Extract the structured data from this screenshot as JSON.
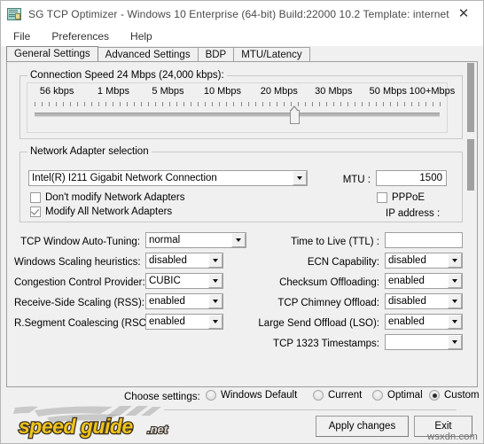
{
  "window": {
    "title": "SG TCP Optimizer - Windows 10 Enterprise (64-bit) Build:22000 10.2  Template: internet",
    "icon": "app-icon",
    "close_label": "✕"
  },
  "menu": {
    "items": [
      {
        "label": "File"
      },
      {
        "label": "Preferences"
      },
      {
        "label": "Help"
      }
    ]
  },
  "tabs": [
    {
      "label": "General Settings",
      "active": true
    },
    {
      "label": "Advanced Settings",
      "active": false
    },
    {
      "label": "BDP",
      "active": false
    },
    {
      "label": "MTU/Latency",
      "active": false
    }
  ],
  "connection_speed": {
    "group_title": "Connection Speed  24 Mbps (24,000 kbps):",
    "scale_labels": [
      "56 kbps",
      "1 Mbps",
      "5 Mbps",
      "10 Mbps",
      "20 Mbps",
      "30 Mbps",
      "50 Mbps",
      "100+Mbps"
    ],
    "value_mbps": 24,
    "value_kbps": 24000,
    "slider_percent": 62
  },
  "network_adapter": {
    "group_title": "Network Adapter selection",
    "adapter_value": "Intel(R) I211 Gigabit Network Connection",
    "dont_modify": {
      "label": "Don't modify Network Adapters",
      "checked": false
    },
    "modify_all": {
      "label": "Modify All Network Adapters",
      "checked": true
    },
    "mtu_label": "MTU :",
    "mtu_value": "1500",
    "pppoe": {
      "label": "PPPoE",
      "checked": false
    },
    "ip_address_label": "IP address :"
  },
  "left_settings": [
    {
      "label": "TCP Window Auto-Tuning:",
      "value": "normal",
      "wide": true
    },
    {
      "label": "Windows Scaling heuristics:",
      "value": "disabled",
      "wide": false
    },
    {
      "label": "Congestion Control Provider:",
      "value": "CUBIC",
      "wide": false
    },
    {
      "label": "Receive-Side Scaling (RSS):",
      "value": "enabled",
      "wide": false
    },
    {
      "label": "R.Segment Coalescing (RSC):",
      "value": "enabled",
      "wide": false
    }
  ],
  "right_settings": [
    {
      "label": "Time to Live (TTL) :",
      "value": "",
      "type": "textbox"
    },
    {
      "label": "ECN Capability:",
      "value": "disabled",
      "type": "combo"
    },
    {
      "label": "Checksum Offloading:",
      "value": "enabled",
      "type": "combo"
    },
    {
      "label": "TCP Chimney Offload:",
      "value": "disabled",
      "type": "combo"
    },
    {
      "label": "Large Send Offload (LSO):",
      "value": "enabled",
      "type": "combo"
    },
    {
      "label": "TCP 1323 Timestamps:",
      "value": "",
      "type": "combo"
    }
  ],
  "choose_settings": {
    "label": "Choose settings:",
    "options": [
      {
        "label": "Windows Default",
        "selected": false
      },
      {
        "label": "Current",
        "selected": false
      },
      {
        "label": "Optimal",
        "selected": false
      },
      {
        "label": "Custom",
        "selected": true
      }
    ]
  },
  "buttons": {
    "apply": "Apply changes",
    "exit": "Exit"
  },
  "branding": {
    "logo_main": "speed guide",
    "logo_suffix": ".net",
    "watermark": "wsxdn.com",
    "logo_color": "#f0c419",
    "logo_outline": "#3a3024"
  }
}
